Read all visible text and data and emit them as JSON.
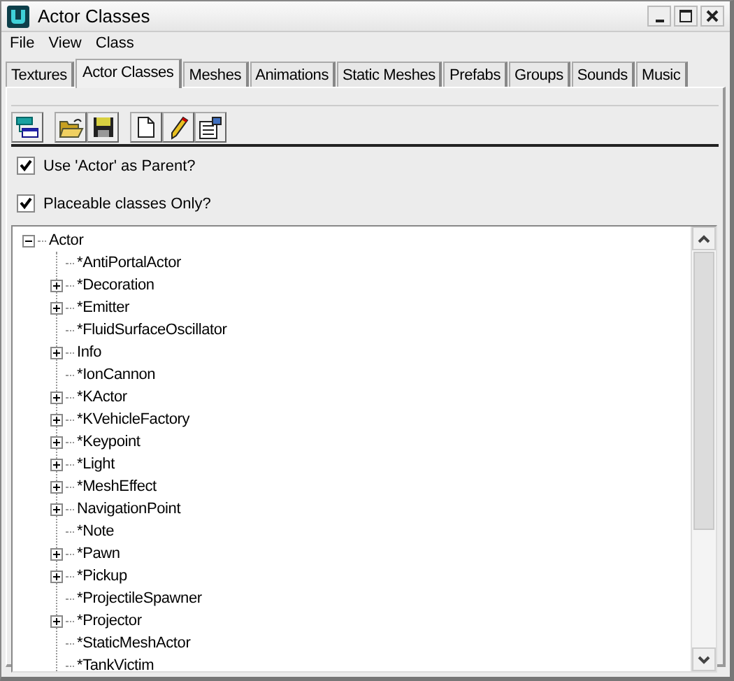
{
  "window": {
    "title": "Actor Classes"
  },
  "menu": [
    "File",
    "View",
    "Class"
  ],
  "tabs": [
    {
      "label": "Textures",
      "selected": false
    },
    {
      "label": "Actor Classes",
      "selected": true
    },
    {
      "label": "Meshes",
      "selected": false
    },
    {
      "label": "Animations",
      "selected": false
    },
    {
      "label": "Static Meshes",
      "selected": false
    },
    {
      "label": "Prefabs",
      "selected": false
    },
    {
      "label": "Groups",
      "selected": false
    },
    {
      "label": "Sounds",
      "selected": false
    },
    {
      "label": "Music",
      "selected": false
    }
  ],
  "options": [
    {
      "label": "Use 'Actor' as Parent?",
      "checked": true
    },
    {
      "label": "Placeable classes Only?",
      "checked": true
    }
  ],
  "tree": [
    {
      "label": "Actor",
      "kind": "branch",
      "expanded": true,
      "children": [
        {
          "label": "*AntiPortalActor",
          "kind": "leaf"
        },
        {
          "label": "*Decoration",
          "kind": "branch",
          "expanded": false
        },
        {
          "label": "*Emitter",
          "kind": "branch",
          "expanded": false
        },
        {
          "label": "*FluidSurfaceOscillator",
          "kind": "leaf"
        },
        {
          "label": "Info",
          "kind": "branch",
          "expanded": false
        },
        {
          "label": "*IonCannon",
          "kind": "leaf"
        },
        {
          "label": "*KActor",
          "kind": "branch",
          "expanded": false
        },
        {
          "label": "*KVehicleFactory",
          "kind": "branch",
          "expanded": false
        },
        {
          "label": "*Keypoint",
          "kind": "branch",
          "expanded": false
        },
        {
          "label": "*Light",
          "kind": "branch",
          "expanded": false
        },
        {
          "label": "*MeshEffect",
          "kind": "branch",
          "expanded": false
        },
        {
          "label": "NavigationPoint",
          "kind": "branch",
          "expanded": false
        },
        {
          "label": "*Note",
          "kind": "leaf"
        },
        {
          "label": "*Pawn",
          "kind": "branch",
          "expanded": false
        },
        {
          "label": "*Pickup",
          "kind": "branch",
          "expanded": false
        },
        {
          "label": "*ProjectileSpawner",
          "kind": "leaf"
        },
        {
          "label": "*Projector",
          "kind": "branch",
          "expanded": false
        },
        {
          "label": "*StaticMeshActor",
          "kind": "leaf"
        },
        {
          "label": "*TankVictim",
          "kind": "leaf"
        }
      ]
    }
  ]
}
